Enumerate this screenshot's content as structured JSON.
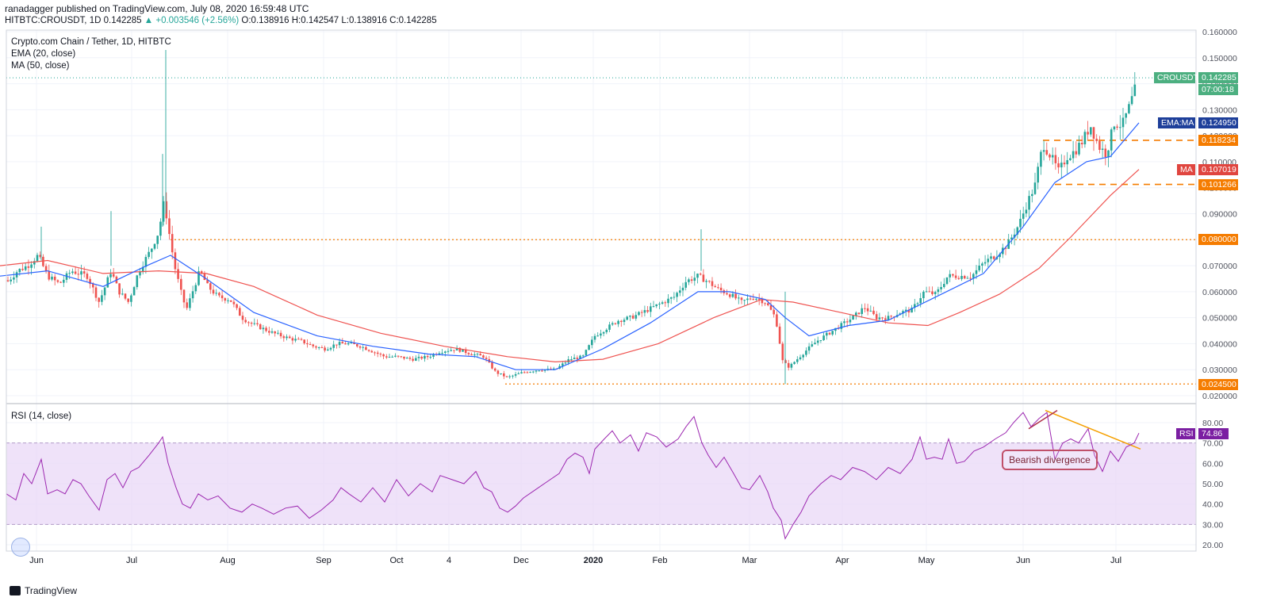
{
  "header": {
    "line1": "ranadagger published on TradingView.com, July 08, 2020 16:59:48 UTC",
    "symbol": "HITBTC:CROUSDT, 1D",
    "last": "0.142285",
    "change": "▲ +0.003546 (+2.56%)",
    "ohlc": "O:0.138916 H:0.142547 L:0.138916 C:0.142285"
  },
  "legend": {
    "title": "Crypto.com Chain / Tether, 1D, HITBTC",
    "ema": "EMA (20, close)",
    "ma": "MA (50, close)",
    "rsi": "RSI (14, close)"
  },
  "tags": {
    "price_name": "CROUSDT",
    "price_value": "0.142285",
    "countdown": "07:00:18",
    "ema_name": "EMA:MA",
    "ema_value": "0.124950",
    "level1": "0.118234",
    "ma_name": "MA",
    "ma_value": "0.107019",
    "level2": "0.101266",
    "level3": "0.080000",
    "level4": "0.024500",
    "rsi_name": "RSI",
    "rsi_value": "74.86"
  },
  "annotation": "Bearish divergence",
  "footer": "TradingView",
  "colors": {
    "up": "#26a69a",
    "down": "#ef5350",
    "ema": "#2962ff",
    "ma": "#ef5350",
    "rsi": "#9c27b0",
    "level": "#f57c00",
    "price_tag": "#4caf80",
    "ema_tag": "#1e3f9a",
    "ma_tag": "#e0453f"
  },
  "chart_data": {
    "type": "candlestick",
    "title": "Crypto.com Chain / Tether, 1D, HITBTC",
    "x_ticks": [
      "Jun",
      "Jul",
      "Aug",
      "Sep",
      "Oct",
      "4",
      "Dec",
      "2020",
      "Feb",
      "Mar",
      "Apr",
      "May",
      "Jun",
      "Jul"
    ],
    "price_axis": {
      "ticks": [
        "0.160000",
        "0.150000",
        "0.140000",
        "0.130000",
        "0.120000",
        "0.110000",
        "0.100000",
        "0.090000",
        "0.080000",
        "0.070000",
        "0.060000",
        "0.050000",
        "0.040000",
        "0.030000",
        "0.020000"
      ],
      "range": [
        0.02,
        0.16
      ]
    },
    "rsi_axis": {
      "ticks": [
        "80.00",
        "70.00",
        "60.00",
        "50.00",
        "40.00",
        "30.00",
        "20.00"
      ],
      "range": [
        20,
        85
      ],
      "band": [
        30,
        70
      ]
    },
    "levels": [
      0.118234,
      0.101266,
      0.08,
      0.0245
    ],
    "price_path": [
      [
        0,
        0.066
      ],
      [
        10,
        0.064
      ],
      [
        22,
        0.068
      ],
      [
        35,
        0.07
      ],
      [
        48,
        0.074
      ],
      [
        60,
        0.066
      ],
      [
        75,
        0.063
      ],
      [
        90,
        0.068
      ],
      [
        110,
        0.066
      ],
      [
        125,
        0.056
      ],
      [
        140,
        0.068
      ],
      [
        150,
        0.06
      ],
      [
        162,
        0.056
      ],
      [
        175,
        0.068
      ],
      [
        190,
        0.076
      ],
      [
        200,
        0.083
      ],
      [
        207,
        0.095
      ],
      [
        212,
        0.085
      ],
      [
        220,
        0.07
      ],
      [
        228,
        0.06
      ],
      [
        235,
        0.053
      ],
      [
        245,
        0.062
      ],
      [
        252,
        0.068
      ],
      [
        262,
        0.062
      ],
      [
        275,
        0.058
      ],
      [
        290,
        0.057
      ],
      [
        305,
        0.05
      ],
      [
        315,
        0.048
      ],
      [
        330,
        0.046
      ],
      [
        345,
        0.044
      ],
      [
        365,
        0.042
      ],
      [
        380,
        0.041
      ],
      [
        395,
        0.039
      ],
      [
        410,
        0.038
      ],
      [
        425,
        0.04
      ],
      [
        440,
        0.04
      ],
      [
        455,
        0.039
      ],
      [
        470,
        0.037
      ],
      [
        485,
        0.035
      ],
      [
        500,
        0.035
      ],
      [
        520,
        0.034
      ],
      [
        540,
        0.035
      ],
      [
        555,
        0.037
      ],
      [
        575,
        0.038
      ],
      [
        595,
        0.036
      ],
      [
        610,
        0.035
      ],
      [
        625,
        0.029
      ],
      [
        640,
        0.027
      ],
      [
        660,
        0.029
      ],
      [
        680,
        0.03
      ],
      [
        700,
        0.03
      ],
      [
        718,
        0.034
      ],
      [
        735,
        0.035
      ],
      [
        750,
        0.043
      ],
      [
        765,
        0.046
      ],
      [
        780,
        0.049
      ],
      [
        795,
        0.05
      ],
      [
        810,
        0.052
      ],
      [
        830,
        0.055
      ],
      [
        850,
        0.058
      ],
      [
        865,
        0.064
      ],
      [
        880,
        0.066
      ],
      [
        892,
        0.064
      ],
      [
        905,
        0.061
      ],
      [
        920,
        0.059
      ],
      [
        935,
        0.056
      ],
      [
        950,
        0.058
      ],
      [
        965,
        0.056
      ],
      [
        978,
        0.05
      ],
      [
        987,
        0.033
      ],
      [
        995,
        0.031
      ],
      [
        1005,
        0.034
      ],
      [
        1015,
        0.037
      ],
      [
        1030,
        0.041
      ],
      [
        1045,
        0.044
      ],
      [
        1060,
        0.047
      ],
      [
        1075,
        0.05
      ],
      [
        1090,
        0.054
      ],
      [
        1105,
        0.05
      ],
      [
        1120,
        0.05
      ],
      [
        1135,
        0.052
      ],
      [
        1150,
        0.053
      ],
      [
        1165,
        0.06
      ],
      [
        1180,
        0.059
      ],
      [
        1195,
        0.066
      ],
      [
        1210,
        0.066
      ],
      [
        1225,
        0.066
      ],
      [
        1240,
        0.071
      ],
      [
        1255,
        0.074
      ],
      [
        1270,
        0.078
      ],
      [
        1285,
        0.086
      ],
      [
        1295,
        0.094
      ],
      [
        1305,
        0.101
      ],
      [
        1315,
        0.117
      ],
      [
        1325,
        0.112
      ],
      [
        1335,
        0.106
      ],
      [
        1345,
        0.112
      ],
      [
        1355,
        0.114
      ],
      [
        1365,
        0.118
      ],
      [
        1375,
        0.124
      ],
      [
        1385,
        0.116
      ],
      [
        1395,
        0.113
      ],
      [
        1405,
        0.125
      ],
      [
        1415,
        0.124
      ],
      [
        1425,
        0.132
      ],
      [
        1436,
        0.142285
      ]
    ],
    "ema_path": [
      [
        0,
        0.066
      ],
      [
        60,
        0.068
      ],
      [
        130,
        0.062
      ],
      [
        185,
        0.07
      ],
      [
        215,
        0.074
      ],
      [
        260,
        0.065
      ],
      [
        320,
        0.052
      ],
      [
        400,
        0.043
      ],
      [
        470,
        0.039
      ],
      [
        540,
        0.036
      ],
      [
        600,
        0.035
      ],
      [
        650,
        0.03
      ],
      [
        700,
        0.03
      ],
      [
        760,
        0.038
      ],
      [
        820,
        0.048
      ],
      [
        880,
        0.06
      ],
      [
        920,
        0.06
      ],
      [
        965,
        0.057
      ],
      [
        990,
        0.05
      ],
      [
        1020,
        0.043
      ],
      [
        1070,
        0.047
      ],
      [
        1120,
        0.049
      ],
      [
        1180,
        0.058
      ],
      [
        1240,
        0.067
      ],
      [
        1290,
        0.085
      ],
      [
        1330,
        0.102
      ],
      [
        1370,
        0.11
      ],
      [
        1400,
        0.112
      ],
      [
        1436,
        0.12495
      ]
    ],
    "ma_path": [
      [
        0,
        0.07
      ],
      [
        60,
        0.072
      ],
      [
        130,
        0.067
      ],
      [
        200,
        0.068
      ],
      [
        260,
        0.067
      ],
      [
        320,
        0.062
      ],
      [
        400,
        0.051
      ],
      [
        480,
        0.044
      ],
      [
        560,
        0.039
      ],
      [
        640,
        0.035
      ],
      [
        700,
        0.033
      ],
      [
        760,
        0.034
      ],
      [
        830,
        0.04
      ],
      [
        900,
        0.05
      ],
      [
        960,
        0.057
      ],
      [
        1000,
        0.056
      ],
      [
        1060,
        0.052
      ],
      [
        1120,
        0.048
      ],
      [
        1170,
        0.047
      ],
      [
        1210,
        0.052
      ],
      [
        1260,
        0.059
      ],
      [
        1310,
        0.069
      ],
      [
        1350,
        0.081
      ],
      [
        1400,
        0.097
      ],
      [
        1436,
        0.107019
      ]
    ],
    "rsi_path": [
      [
        8,
        45
      ],
      [
        20,
        42
      ],
      [
        30,
        55
      ],
      [
        40,
        50
      ],
      [
        52,
        62
      ],
      [
        60,
        45
      ],
      [
        72,
        47
      ],
      [
        82,
        45
      ],
      [
        92,
        52
      ],
      [
        102,
        50
      ],
      [
        112,
        44
      ],
      [
        125,
        37
      ],
      [
        135,
        52
      ],
      [
        145,
        55
      ],
      [
        155,
        48
      ],
      [
        165,
        56
      ],
      [
        175,
        58
      ],
      [
        188,
        64
      ],
      [
        200,
        70
      ],
      [
        205,
        73
      ],
      [
        212,
        60
      ],
      [
        222,
        48
      ],
      [
        230,
        40
      ],
      [
        240,
        38
      ],
      [
        250,
        45
      ],
      [
        262,
        42
      ],
      [
        275,
        44
      ],
      [
        290,
        38
      ],
      [
        305,
        36
      ],
      [
        318,
        40
      ],
      [
        330,
        38
      ],
      [
        345,
        35
      ],
      [
        360,
        38
      ],
      [
        375,
        39
      ],
      [
        390,
        33
      ],
      [
        405,
        37
      ],
      [
        420,
        42
      ],
      [
        430,
        48
      ],
      [
        440,
        45
      ],
      [
        455,
        41
      ],
      [
        470,
        48
      ],
      [
        485,
        41
      ],
      [
        500,
        52
      ],
      [
        515,
        44
      ],
      [
        530,
        50
      ],
      [
        545,
        46
      ],
      [
        555,
        54
      ],
      [
        570,
        52
      ],
      [
        585,
        50
      ],
      [
        600,
        56
      ],
      [
        610,
        48
      ],
      [
        620,
        46
      ],
      [
        630,
        38
      ],
      [
        640,
        36
      ],
      [
        650,
        39
      ],
      [
        660,
        43
      ],
      [
        675,
        47
      ],
      [
        690,
        51
      ],
      [
        705,
        55
      ],
      [
        715,
        62
      ],
      [
        725,
        65
      ],
      [
        735,
        63
      ],
      [
        743,
        55
      ],
      [
        750,
        67
      ],
      [
        762,
        72
      ],
      [
        772,
        76
      ],
      [
        782,
        70
      ],
      [
        795,
        74
      ],
      [
        805,
        66
      ],
      [
        815,
        75
      ],
      [
        828,
        73
      ],
      [
        840,
        68
      ],
      [
        855,
        72
      ],
      [
        865,
        78
      ],
      [
        875,
        83
      ],
      [
        885,
        70
      ],
      [
        893,
        64
      ],
      [
        903,
        58
      ],
      [
        913,
        63
      ],
      [
        925,
        55
      ],
      [
        935,
        48
      ],
      [
        945,
        47
      ],
      [
        958,
        54
      ],
      [
        968,
        46
      ],
      [
        975,
        38
      ],
      [
        985,
        32
      ],
      [
        990,
        23
      ],
      [
        1000,
        30
      ],
      [
        1010,
        36
      ],
      [
        1020,
        44
      ],
      [
        1035,
        50
      ],
      [
        1048,
        54
      ],
      [
        1060,
        52
      ],
      [
        1075,
        58
      ],
      [
        1090,
        56
      ],
      [
        1105,
        52
      ],
      [
        1120,
        58
      ],
      [
        1135,
        55
      ],
      [
        1150,
        62
      ],
      [
        1160,
        73
      ],
      [
        1168,
        62
      ],
      [
        1178,
        63
      ],
      [
        1188,
        62
      ],
      [
        1196,
        72
      ],
      [
        1206,
        60
      ],
      [
        1216,
        61
      ],
      [
        1228,
        66
      ],
      [
        1240,
        68
      ],
      [
        1255,
        72
      ],
      [
        1268,
        75
      ],
      [
        1278,
        80
      ],
      [
        1290,
        85
      ],
      [
        1300,
        78
      ],
      [
        1310,
        82
      ],
      [
        1320,
        85
      ],
      [
        1330,
        62
      ],
      [
        1340,
        70
      ],
      [
        1350,
        72
      ],
      [
        1360,
        70
      ],
      [
        1372,
        77
      ],
      [
        1380,
        64
      ],
      [
        1390,
        56
      ],
      [
        1400,
        66
      ],
      [
        1410,
        61
      ],
      [
        1420,
        68
      ],
      [
        1430,
        70
      ],
      [
        1436,
        74.86
      ]
    ],
    "divergence_lines": {
      "price_high": [
        [
          1318,
          0.118
        ],
        [
          1375,
          0.125
        ]
      ],
      "rsi_trend": [
        [
          1318,
          86
        ],
        [
          1438,
          67
        ]
      ],
      "rsi_short": [
        [
          1297,
          77
        ],
        [
          1333,
          86
        ]
      ]
    }
  }
}
